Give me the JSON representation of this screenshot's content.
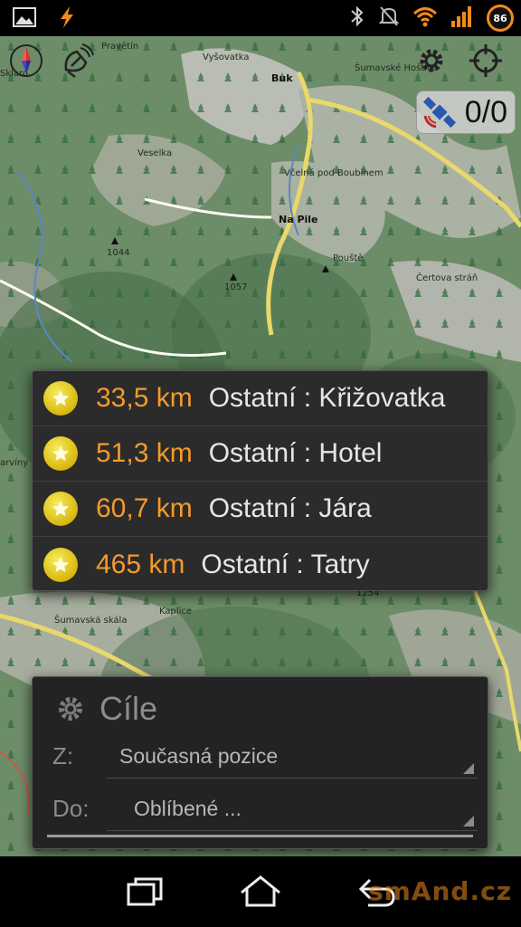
{
  "status_bar": {
    "left_icons": [
      "gallery-icon",
      "flash-icon"
    ],
    "right_icons": [
      "bluetooth-icon",
      "mute-icon",
      "wifi-icon",
      "signal-icon"
    ],
    "battery_level": "86",
    "accent": "#f08a1c"
  },
  "map": {
    "labels": {
      "pravetin": "Pravětín",
      "vysovatka": "Vyšovatka",
      "buk": "Buk",
      "sumavske_hosky": "Šumavské Hoštice",
      "veselka": "Veselka",
      "vcelna": "Včelná pod Boubínem",
      "na_pile": "Na Pile",
      "peak_1044": "1044",
      "peak_1057": "1057",
      "pouli": "Pouště",
      "certova_stran": "Čertova stráň",
      "sumava_skala": "Šumavská skála",
      "kaplice": "Kaplice",
      "sklaro": "Sklaro",
      "varstvi": "arvíny",
      "peak_1254": "1254"
    }
  },
  "gps": {
    "satellites": "0/0"
  },
  "favorites": [
    {
      "distance": "33,5 km",
      "name": "Ostatní : Křižovatka"
    },
    {
      "distance": "51,3 km",
      "name": "Ostatní : Hotel"
    },
    {
      "distance": "60,7 km",
      "name": "Ostatní : Jára"
    },
    {
      "distance": "465 km",
      "name": "Ostatní : Tatry"
    }
  ],
  "destination": {
    "title": "Cíle",
    "from_label": "Z:",
    "from_value": "Současná pozice",
    "to_label": "Do:",
    "to_value": "Oblíbené ..."
  },
  "nav_bar": {
    "watermark": "smAnd.cz"
  }
}
